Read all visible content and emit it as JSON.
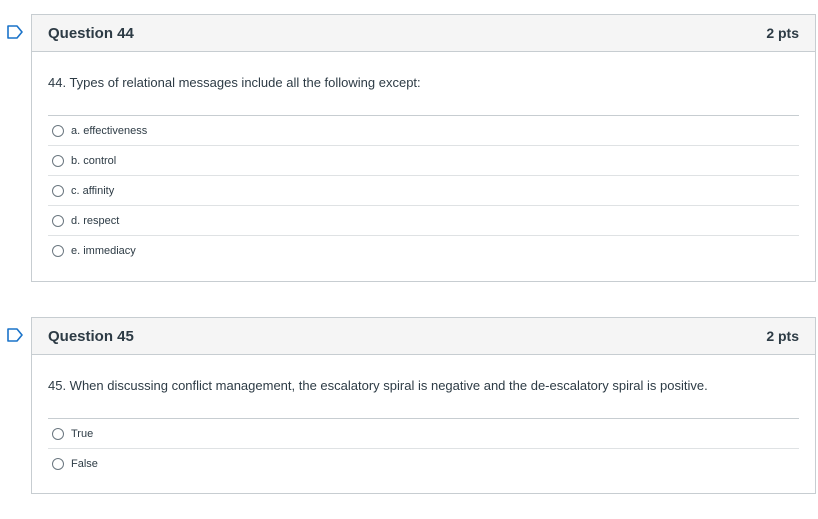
{
  "colors": {
    "flag_accent": "#1a73c9",
    "header_bg": "#f5f5f5",
    "border": "#c7cdd1",
    "text": "#2d3b45"
  },
  "questions": [
    {
      "flag_icon": "bookmark-flag-icon",
      "title": "Question 44",
      "points": "2 pts",
      "text": "44. Types of relational messages include all the following except:",
      "answers": [
        "a. effectiveness",
        "b. control",
        "c. affinity",
        "d. respect",
        "e. immediacy"
      ]
    },
    {
      "flag_icon": "bookmark-flag-icon",
      "title": "Question 45",
      "points": "2 pts",
      "text": "45. When discussing conflict management, the escalatory spiral is negative and the de-escalatory spiral is positive.",
      "answers": [
        "True",
        "False"
      ]
    }
  ]
}
